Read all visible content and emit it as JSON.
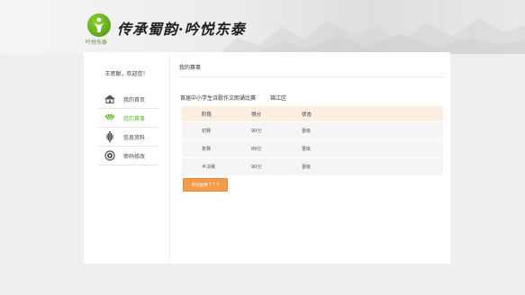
{
  "header": {
    "logo_title": "传承蜀韵·吟悦东泰",
    "logo_subtitle": "吟悦东泰"
  },
  "sidebar": {
    "welcome": "王思聪，欢迎您！",
    "items": [
      {
        "label": "我的首页",
        "icon": "house-icon",
        "active": false
      },
      {
        "label": "我的赛事",
        "icon": "fan-icon",
        "active": true
      },
      {
        "label": "信息资料",
        "icon": "lantern-icon",
        "active": false
      },
      {
        "label": "密码修改",
        "icon": "coin-icon",
        "active": false
      }
    ]
  },
  "main": {
    "section_title": "我的赛事",
    "event_name": "首届中小学生诗歌作文朗诵比赛",
    "event_region": "锦江区",
    "table": {
      "headers": [
        "阶段",
        "得分",
        "状态"
      ],
      "rows": [
        [
          "初赛",
          "90分",
          "晋级"
        ],
        [
          "复赛",
          "89分",
          "晋级"
        ],
        [
          "半决赛",
          "90分",
          "晋级"
        ]
      ]
    },
    "join_button": "参加复赛 T T T"
  },
  "colors": {
    "accent_green": "#6ab830",
    "button_orange": "#f29a4a",
    "table_header_bg": "#fdeee2"
  }
}
